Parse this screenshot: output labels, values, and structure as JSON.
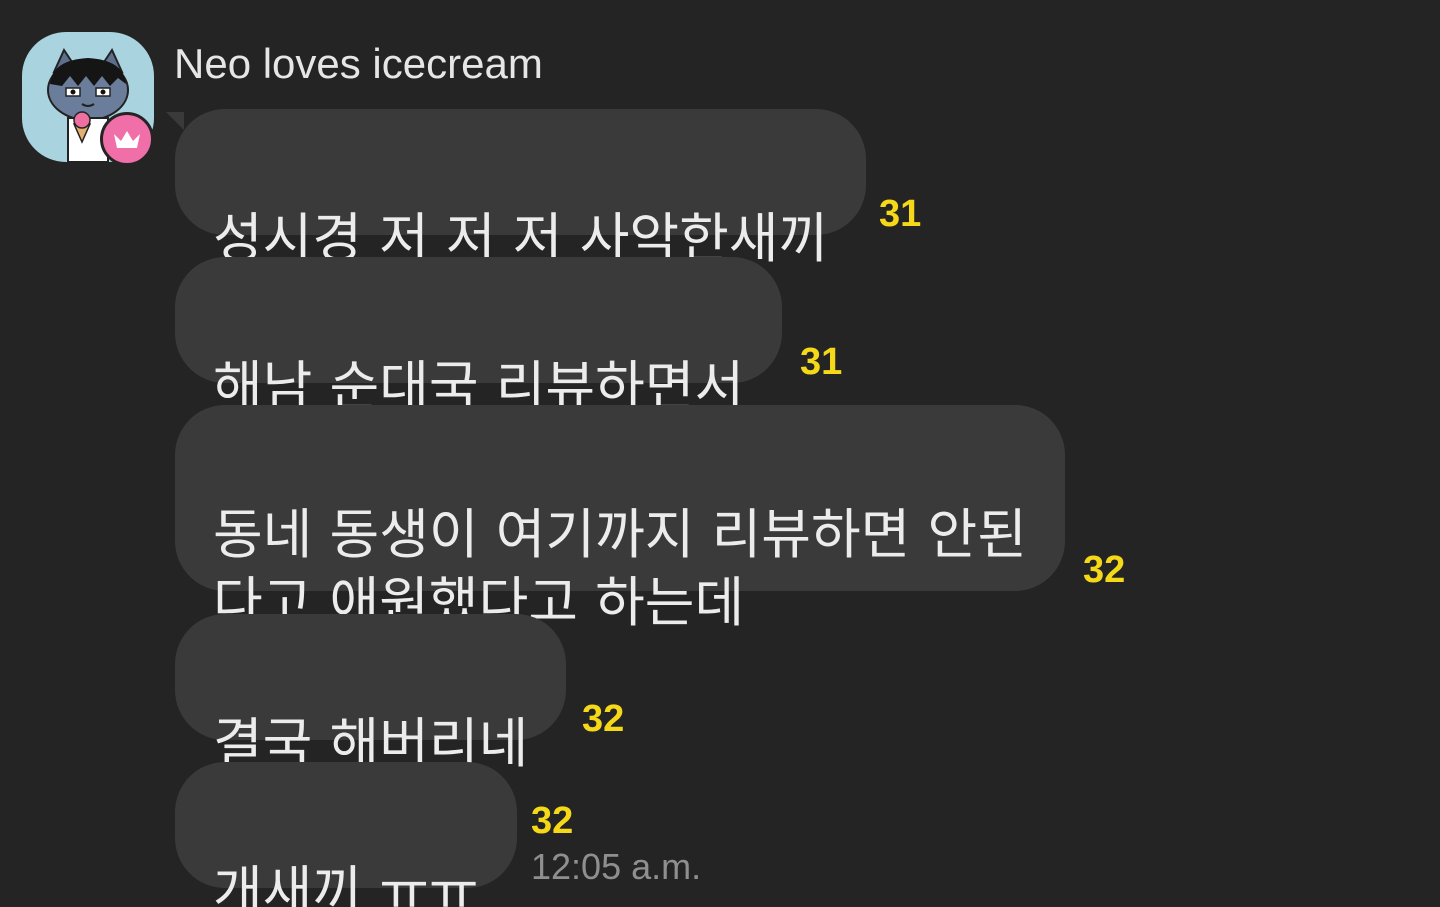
{
  "sender": {
    "name": "Neo loves icecream",
    "avatar_icon": "neo-cat-avatar-icon",
    "badge_icon": "crown-icon",
    "badge_color": "#f06fa8"
  },
  "messages": [
    {
      "text": "성시경 저 저 저 사악한새끼",
      "unread": "31"
    },
    {
      "text": "해남 순대국 리뷰하면서",
      "unread": "31"
    },
    {
      "text": "동네 동생이 여기까지 리뷰하면 안된\n다고 애원했다고 하는데",
      "unread": "32"
    },
    {
      "text": "결국 해버리네",
      "unread": "32"
    },
    {
      "text": "개새끼 ㅠㅠ",
      "unread": "32",
      "time": "12:05 a.m."
    }
  ],
  "colors": {
    "background": "#242424",
    "bubble": "#3a3a3a",
    "unread": "#f5d818",
    "time": "#8f8f8f"
  }
}
